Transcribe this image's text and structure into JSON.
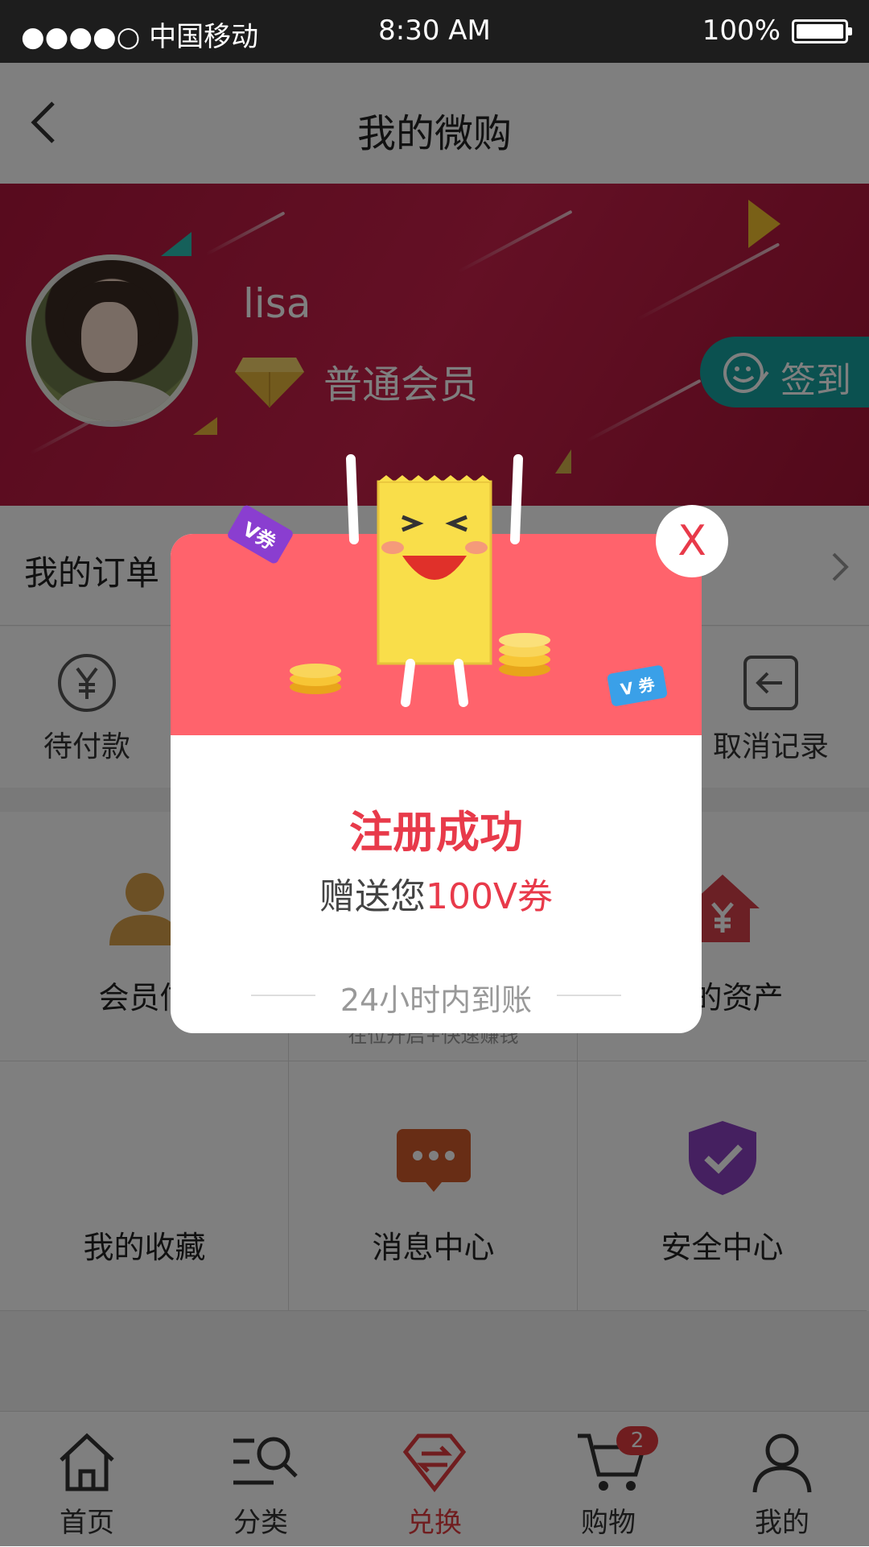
{
  "status_bar": {
    "carrier": "●●●●○ 中国移动",
    "time": "8:30 AM",
    "battery": "100%"
  },
  "nav": {
    "title": "我的微购"
  },
  "profile": {
    "username": "lisa",
    "level": "普通会员",
    "signin": "签到"
  },
  "orders": {
    "title": "我的订单",
    "items": [
      {
        "label": "待付款",
        "icon": "yen-circle-icon"
      },
      {
        "label": "取消记录",
        "icon": "return-box-icon"
      }
    ]
  },
  "grid": {
    "items": [
      {
        "label": "会员信",
        "icon": "member-icon"
      },
      {
        "label": "",
        "sub": "在位开启+快速赚钱",
        "icon": ""
      },
      {
        "label": "我的资产",
        "icon": "assets-house-icon"
      },
      {
        "label": "我的收藏",
        "icon": ""
      },
      {
        "label": "消息中心",
        "icon": "message-icon"
      },
      {
        "label": "安全中心",
        "icon": "shield-check-icon"
      }
    ]
  },
  "tabbar": {
    "items": [
      {
        "label": "首页",
        "icon": "home-icon"
      },
      {
        "label": "分类",
        "icon": "category-search-icon"
      },
      {
        "label": "兑换",
        "icon": "exchange-icon"
      },
      {
        "label": "购物",
        "icon": "cart-icon",
        "badge": "2"
      },
      {
        "label": "我的",
        "icon": "user-icon"
      }
    ],
    "active": "兑换"
  },
  "modal": {
    "title": "注册成功",
    "message_prefix": "赠送您",
    "message_highlight": "100V券",
    "note": "24小时内到账",
    "close_label": "X",
    "tag1": "V券",
    "tag2": "V 券"
  },
  "colors": {
    "accent": "#e83a4a",
    "hero": "#c8204a",
    "teal": "#17a3a0",
    "modal_top": "#ff636c"
  }
}
